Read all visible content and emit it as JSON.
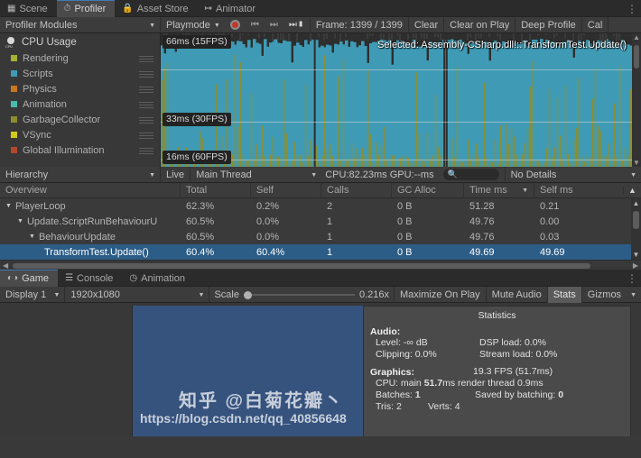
{
  "profiler_window": {
    "tabs": [
      {
        "label": "Scene",
        "icon": "grid-icon",
        "active": false
      },
      {
        "label": "Profiler",
        "icon": "stopwatch-icon",
        "active": true
      },
      {
        "label": "Asset Store",
        "icon": "bag-icon",
        "active": false
      },
      {
        "label": "Animator",
        "icon": "animator-icon",
        "active": false
      }
    ],
    "kebab": "⋮",
    "toolbar": {
      "modules_dropdown": "Profiler Modules",
      "playmode_dropdown": "Playmode",
      "record_button": "record-button",
      "prev_frame": "◀◣",
      "next_frame": "▶",
      "last_frame": "▶▶",
      "frame_label": "Frame: 1399 / 1399",
      "clear": "Clear",
      "clear_on_play": "Clear on Play",
      "deep_profile": "Deep Profile",
      "call_stacks": "Cal"
    },
    "modules": {
      "header": "CPU Usage",
      "items": [
        {
          "label": "Rendering",
          "color": "#a5b230"
        },
        {
          "label": "Scripts",
          "color": "#3f9bb5"
        },
        {
          "label": "Physics",
          "color": "#c9761e"
        },
        {
          "label": "Animation",
          "color": "#4ab8ae"
        },
        {
          "label": "GarbageCollector",
          "color": "#8e8c2c"
        },
        {
          "label": "VSync",
          "color": "#d2c818"
        },
        {
          "label": "Global Illumination",
          "color": "#b1482e"
        }
      ]
    },
    "chart": {
      "selected_label": "Selected: Assembly-CSharp.dll!::TransformTest.Update()",
      "fps_markers": [
        {
          "label": "66ms (15FPS)",
          "ms": 66,
          "fps": 15
        },
        {
          "label": "33ms (30FPS)",
          "ms": 33,
          "fps": 30
        },
        {
          "label": "16ms (60FPS)",
          "ms": 16,
          "fps": 60
        }
      ]
    }
  },
  "hierarchy": {
    "toolbar": {
      "view_dropdown": "Hierarchy",
      "live_label": "Live",
      "thread_dropdown": "Main Thread",
      "cpu_gpu_label": "CPU:82.23ms  GPU:--ms",
      "search_icon": "search-icon",
      "search_value": "",
      "details_dropdown": "No Details"
    },
    "columns": [
      "Overview",
      "Total",
      "Self",
      "Calls",
      "GC Alloc",
      "Time ms",
      "Self ms"
    ],
    "sorted_column": "Time ms",
    "rows": [
      {
        "name": "PlayerLoop",
        "depth": 0,
        "expanded": true,
        "total": "62.3%",
        "self": "0.2%",
        "calls": "2",
        "gc": "0 B",
        "time_ms": "51.28",
        "self_ms": "0.21",
        "selected": false
      },
      {
        "name": "Update.ScriptRunBehaviourU",
        "depth": 1,
        "expanded": true,
        "total": "60.5%",
        "self": "0.0%",
        "calls": "1",
        "gc": "0 B",
        "time_ms": "49.76",
        "self_ms": "0.00",
        "selected": false
      },
      {
        "name": "BehaviourUpdate",
        "depth": 2,
        "expanded": true,
        "total": "60.5%",
        "self": "0.0%",
        "calls": "1",
        "gc": "0 B",
        "time_ms": "49.76",
        "self_ms": "0.03",
        "selected": false
      },
      {
        "name": "TransformTest.Update()",
        "depth": 3,
        "expanded": false,
        "total": "60.4%",
        "self": "60.4%",
        "calls": "1",
        "gc": "0 B",
        "time_ms": "49.69",
        "self_ms": "49.69",
        "selected": true
      }
    ]
  },
  "game_window": {
    "tabs": [
      {
        "label": "Game",
        "icon": "gamepad-icon",
        "active": true
      },
      {
        "label": "Console",
        "icon": "console-icon",
        "active": false
      },
      {
        "label": "Animation",
        "icon": "clock-icon",
        "active": false
      }
    ],
    "kebab": "⋮",
    "toolbar": {
      "display_dropdown": "Display 1",
      "resolution_dropdown": "1920x1080",
      "scale_label": "Scale",
      "scale_value": "0.216x",
      "maximize_on_play": "Maximize On Play",
      "mute_audio": "Mute Audio",
      "stats": "Stats",
      "gizmos": "Gizmos"
    },
    "statistics": {
      "title": "Statistics",
      "audio_header": "Audio:",
      "audio_level": "Level: -∞ dB",
      "audio_clipping": "Clipping: 0.0%",
      "dsp_load": "DSP load: 0.0%",
      "stream_load": "Stream load: 0.0%",
      "graphics_header": "Graphics:",
      "fps": "19.3 FPS (51.7ms)",
      "cpu_line_pre": "CPU: main ",
      "cpu_main": "51.7",
      "cpu_line_post": "ms  render thread 0.9ms",
      "batches_pre": "Batches: ",
      "batches": "1",
      "saved_by_batching_label": "Saved by batching: ",
      "saved_by_batching": "0",
      "tris": "Tris: 2",
      "verts": "Verts: 4"
    }
  },
  "watermark": {
    "cn": "知乎 @白菊花瓣丶",
    "url": "https://blog.csdn.net/qq_40856648"
  }
}
